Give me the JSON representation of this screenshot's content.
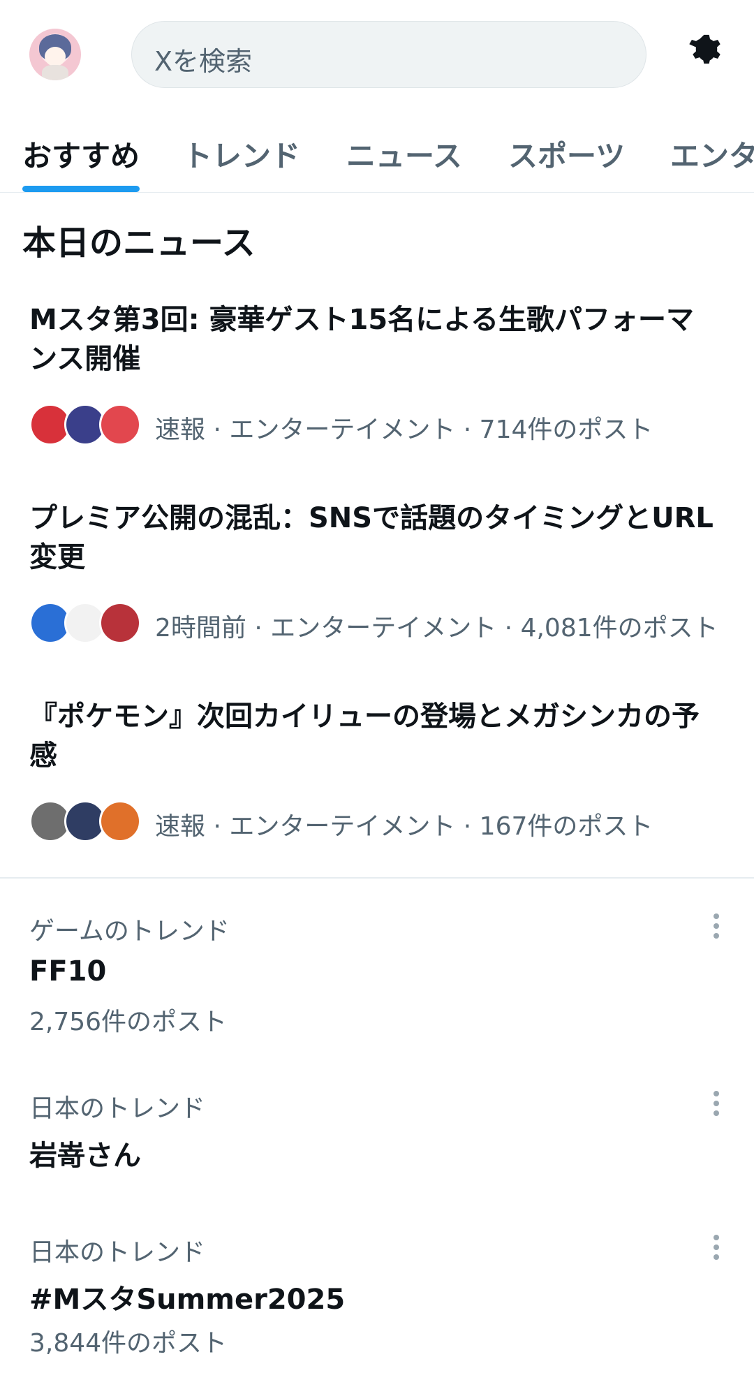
{
  "header": {
    "search_placeholder": "Xを検索"
  },
  "tabs": [
    {
      "label": "おすすめ",
      "active": true
    },
    {
      "label": "トレンド",
      "active": false
    },
    {
      "label": "ニュース",
      "active": false
    },
    {
      "label": "スポーツ",
      "active": false
    },
    {
      "label": "エンタ",
      "active": false
    }
  ],
  "news": {
    "heading": "本日のニュース",
    "items": [
      {
        "title": "Mスタ第3回: 豪華ゲスト15名による生歌パフォーマンス開催",
        "meta": "速報 · エンターテイメント · 714件のポスト",
        "avatar_colors": [
          "#d8313a",
          "#3a3f8a",
          "#e2474e"
        ]
      },
      {
        "title": "プレミア公開の混乱：SNSで話題のタイミングとURL変更",
        "meta": "2時間前 · エンターテイメント · 4,081件のポスト",
        "avatar_colors": [
          "#2a6fd6",
          "#f2f2f2",
          "#b8323a"
        ]
      },
      {
        "title": "『ポケモン』次回カイリューの登場とメガシンカの予感",
        "meta": "速報 · エンターテイメント · 167件のポスト",
        "avatar_colors": [
          "#6e6e6e",
          "#2f3d63",
          "#e0702a"
        ]
      }
    ]
  },
  "trends": [
    {
      "category": "ゲームのトレンド",
      "name": "FF10",
      "count": "2,756件のポスト"
    },
    {
      "category": "日本のトレンド",
      "name": "岩嵜さん",
      "count": ""
    },
    {
      "category": "日本のトレンド",
      "name": "#MスタSummer2025",
      "count": "3,844件のポスト"
    }
  ],
  "colors": {
    "accent": "#1d9bf0",
    "text_primary": "#0f1419",
    "text_secondary": "#536471"
  },
  "icons": {
    "settings": "gear-icon",
    "more": "more-options-icon"
  }
}
